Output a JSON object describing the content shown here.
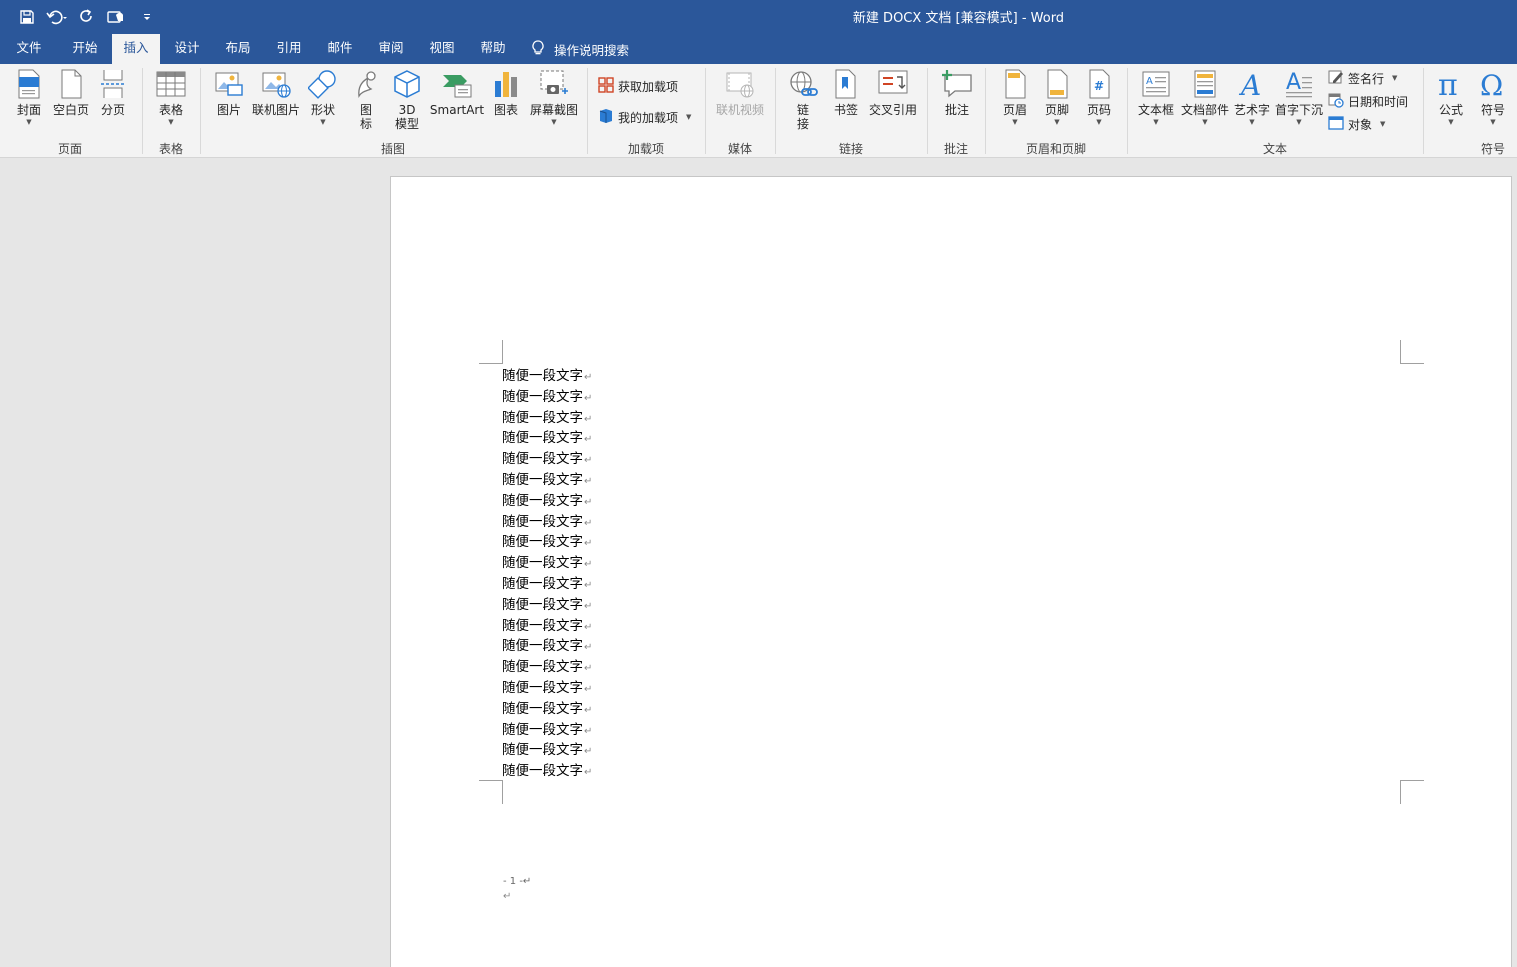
{
  "window": {
    "title": "新建 DOCX 文档 [兼容模式]  -  Word"
  },
  "qat": {
    "save_icon": "save-icon",
    "undo_icon": "undo-icon",
    "redo_icon": "redo-icon",
    "touch_icon": "touch-mode-icon",
    "customize_icon": "customize-qat-icon"
  },
  "tabs": [
    {
      "label": "文件"
    },
    {
      "label": "开始"
    },
    {
      "label": "插入",
      "active": true
    },
    {
      "label": "设计"
    },
    {
      "label": "布局"
    },
    {
      "label": "引用"
    },
    {
      "label": "邮件"
    },
    {
      "label": "审阅"
    },
    {
      "label": "视图"
    },
    {
      "label": "帮助"
    }
  ],
  "tellme": {
    "label": "操作说明搜索",
    "icon": "lightbulb-icon"
  },
  "ribbon": {
    "groups": {
      "pages": "页面",
      "tables": "表格",
      "illustrations": "插图",
      "addins": "加载项",
      "media": "媒体",
      "links": "链接",
      "comments": "批注",
      "header_footer": "页眉和页脚",
      "text": "文本",
      "symbols": "符号"
    },
    "buttons": {
      "cover": "封面",
      "blank_page": "空白页",
      "page_break": "分页",
      "table": "表格",
      "pictures": "图片",
      "online_pictures": "联机图片",
      "shapes": "形状",
      "icons_l1": "图",
      "icons_l2": "标",
      "model_l1": "3D",
      "model_l2": "模型",
      "smartart": "SmartArt",
      "chart": "图表",
      "screenshot": "屏幕截图",
      "get_addins": "获取加载项",
      "my_addins": "我的加载项",
      "online_video": "联机视频",
      "link_l1": "链",
      "link_l2": "接",
      "bookmark": "书签",
      "cross_ref": "交叉引用",
      "comment": "批注",
      "header": "页眉",
      "footer": "页脚",
      "page_number": "页码",
      "textbox": "文本框",
      "quick_parts": "文档部件",
      "wordart": "艺术字",
      "dropcap": "首字下沉",
      "signature": "签名行",
      "datetime": "日期和时间",
      "object": "对象",
      "equation": "公式",
      "symbol": "符号"
    }
  },
  "document": {
    "lines": [
      "随便一段文字",
      "随便一段文字",
      "随便一段文字",
      "随便一段文字",
      "随便一段文字",
      "随便一段文字",
      "随便一段文字",
      "随便一段文字",
      "随便一段文字",
      "随便一段文字",
      "随便一段文字",
      "随便一段文字",
      "随便一段文字",
      "随便一段文字",
      "随便一段文字",
      "随便一段文字",
      "随便一段文字",
      "随便一段文字",
      "随便一段文字",
      "随便一段文字"
    ],
    "paragraph_mark": "↵",
    "page_number_text": "- 1 -↵",
    "footer_mark": "↵"
  }
}
